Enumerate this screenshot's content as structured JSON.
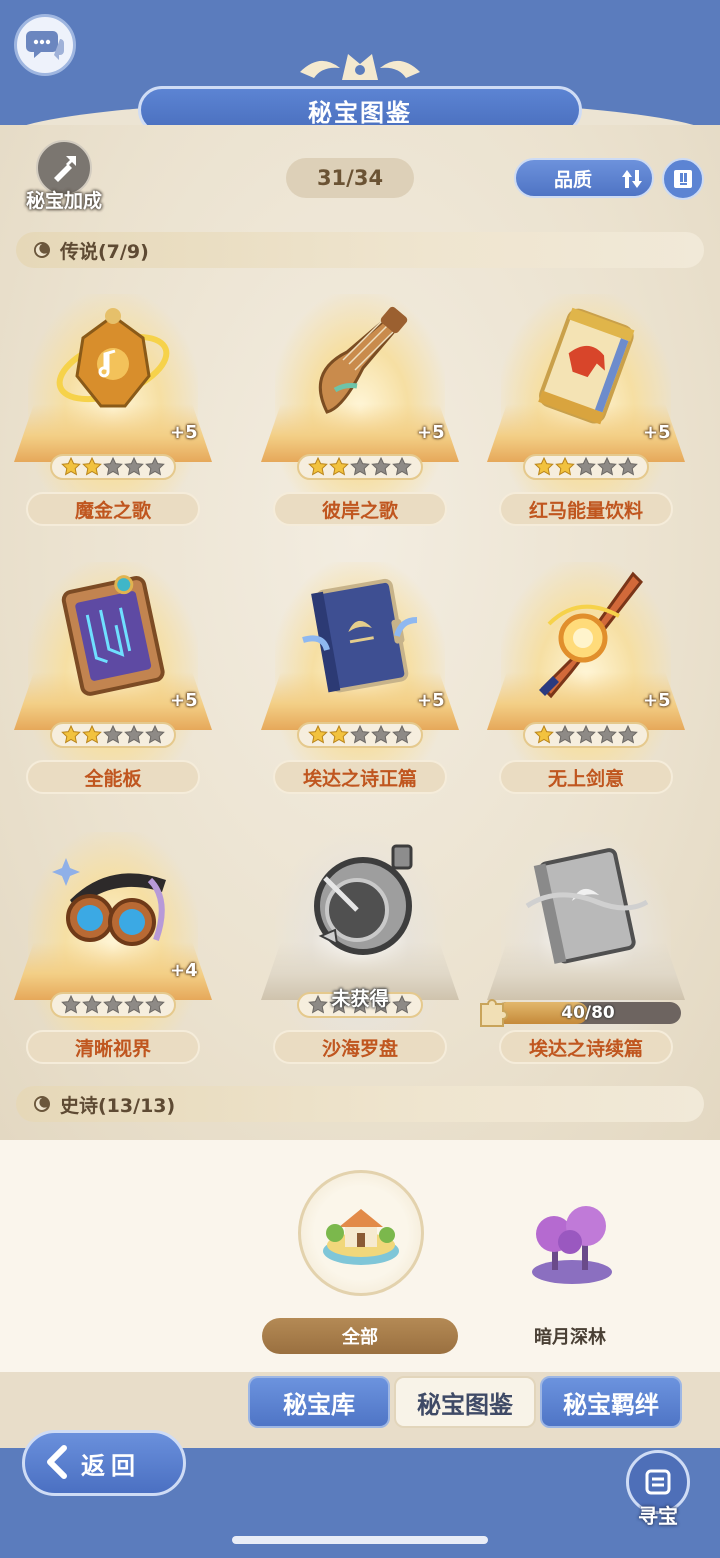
{
  "header": {
    "title": "秘宝图鉴"
  },
  "toolbar": {
    "bonus_label": "秘宝加成",
    "collection_count": "31/34",
    "sort_label": "品质"
  },
  "sections": [
    {
      "title": "传说(7/9)"
    },
    {
      "title": "史诗(13/13)"
    }
  ],
  "cards": [
    {
      "name": "魔金之歌",
      "plus": "+5",
      "stars_filled": 2,
      "stars_total": 5,
      "state": "owned"
    },
    {
      "name": "彼岸之歌",
      "plus": "+5",
      "stars_filled": 2,
      "stars_total": 5,
      "state": "owned"
    },
    {
      "name": "红马能量饮料",
      "plus": "+5",
      "stars_filled": 2,
      "stars_total": 5,
      "state": "owned"
    },
    {
      "name": "全能板",
      "plus": "+5",
      "stars_filled": 2,
      "stars_total": 5,
      "state": "owned"
    },
    {
      "name": "埃达之诗正篇",
      "plus": "+5",
      "stars_filled": 2,
      "stars_total": 5,
      "state": "owned"
    },
    {
      "name": "无上剑意",
      "plus": "+5",
      "stars_filled": 1,
      "stars_total": 5,
      "state": "owned"
    },
    {
      "name": "清晰视界",
      "plus": "+4",
      "stars_filled": 0,
      "stars_total": 5,
      "state": "owned"
    },
    {
      "name": "沙海罗盘",
      "status": "未获得",
      "stars_filled": 0,
      "stars_total": 5,
      "state": "unobtained"
    },
    {
      "name": "埃达之诗续篇",
      "progress_text": "40/80",
      "progress_fraction": 0.5,
      "state": "fragments"
    }
  ],
  "region_filter": {
    "all_label": "全部",
    "forest_label": "暗月深林"
  },
  "tabs": [
    {
      "label": "秘宝库",
      "active": false
    },
    {
      "label": "秘宝图鉴",
      "active": true
    },
    {
      "label": "秘宝羁绊",
      "active": false
    }
  ],
  "footer": {
    "back_label": "返回",
    "treasure_label": "寻宝"
  },
  "colors": {
    "frame_blue": "#5b7cbd",
    "name_text": "#c0561f",
    "star_gold": "#f2c23e",
    "star_grey": "#8e8a86"
  }
}
